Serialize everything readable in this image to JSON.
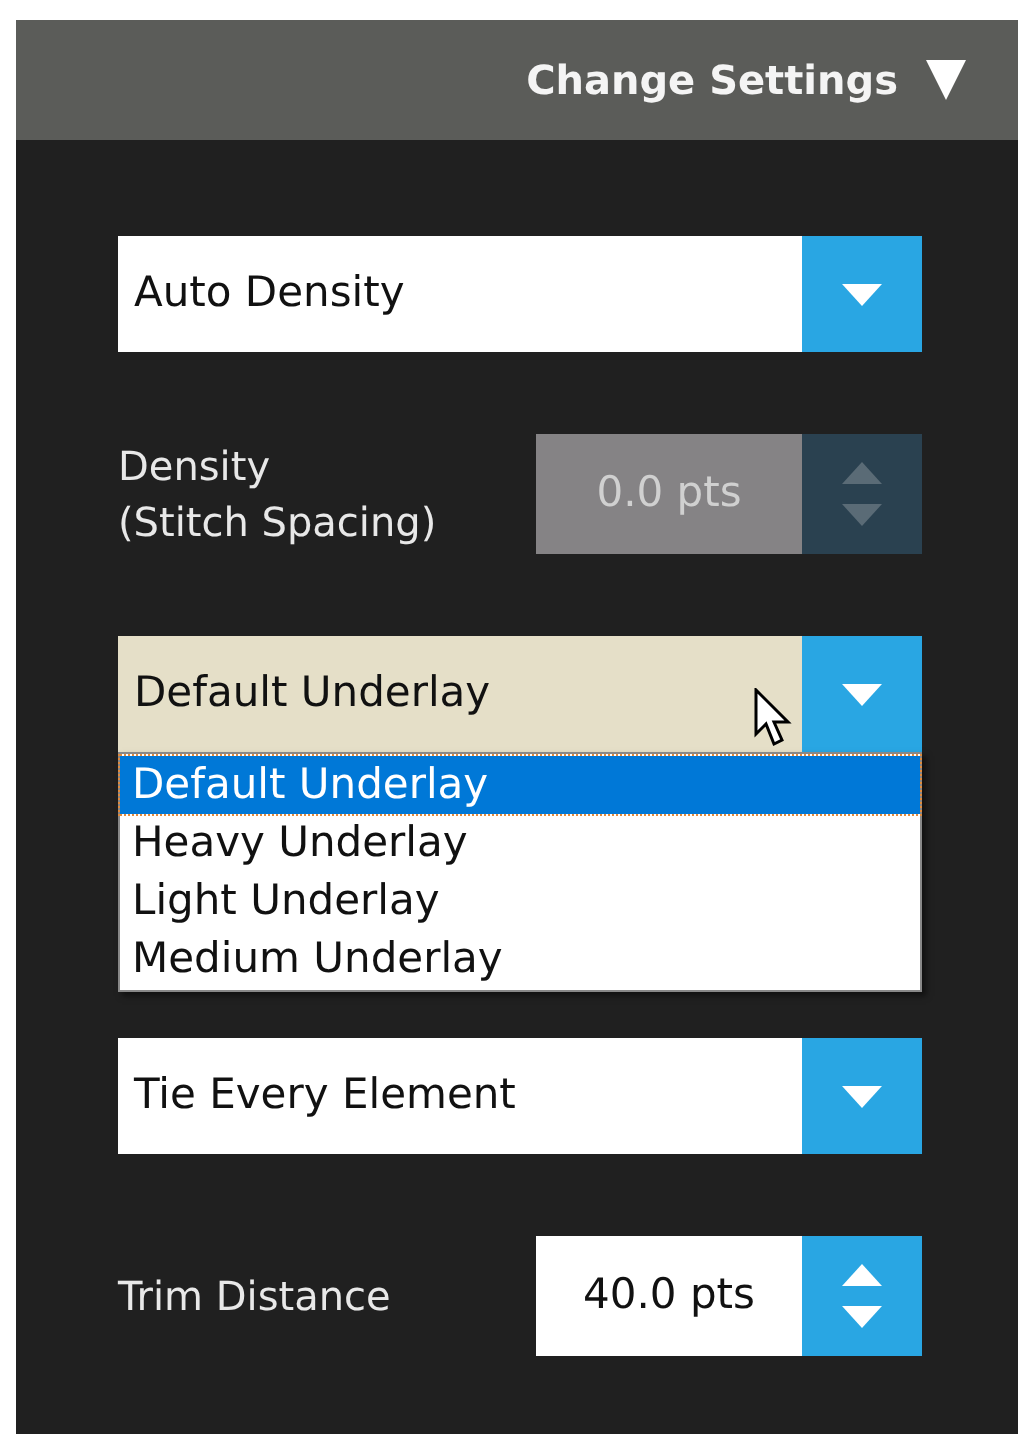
{
  "header": {
    "title": "Change Settings"
  },
  "controls": [
    {
      "kind": "dropdown",
      "value": "Auto Density",
      "open": false
    },
    {
      "kind": "spinner",
      "label": "Density\n(Stitch Spacing)",
      "value": "0.0 pts",
      "disabled": true
    },
    {
      "kind": "dropdown",
      "value": "Default Underlay",
      "open": true,
      "options": [
        {
          "label": "Default Underlay",
          "selected": true
        },
        {
          "label": "Heavy Underlay",
          "selected": false
        },
        {
          "label": "Light Underlay",
          "selected": false
        },
        {
          "label": "Medium Underlay",
          "selected": false
        }
      ]
    },
    {
      "kind": "dropdown",
      "value": "Tie Every Element",
      "open": false
    },
    {
      "kind": "spinner",
      "label": "Trim Distance",
      "value": "40.0 pts",
      "disabled": false
    }
  ]
}
